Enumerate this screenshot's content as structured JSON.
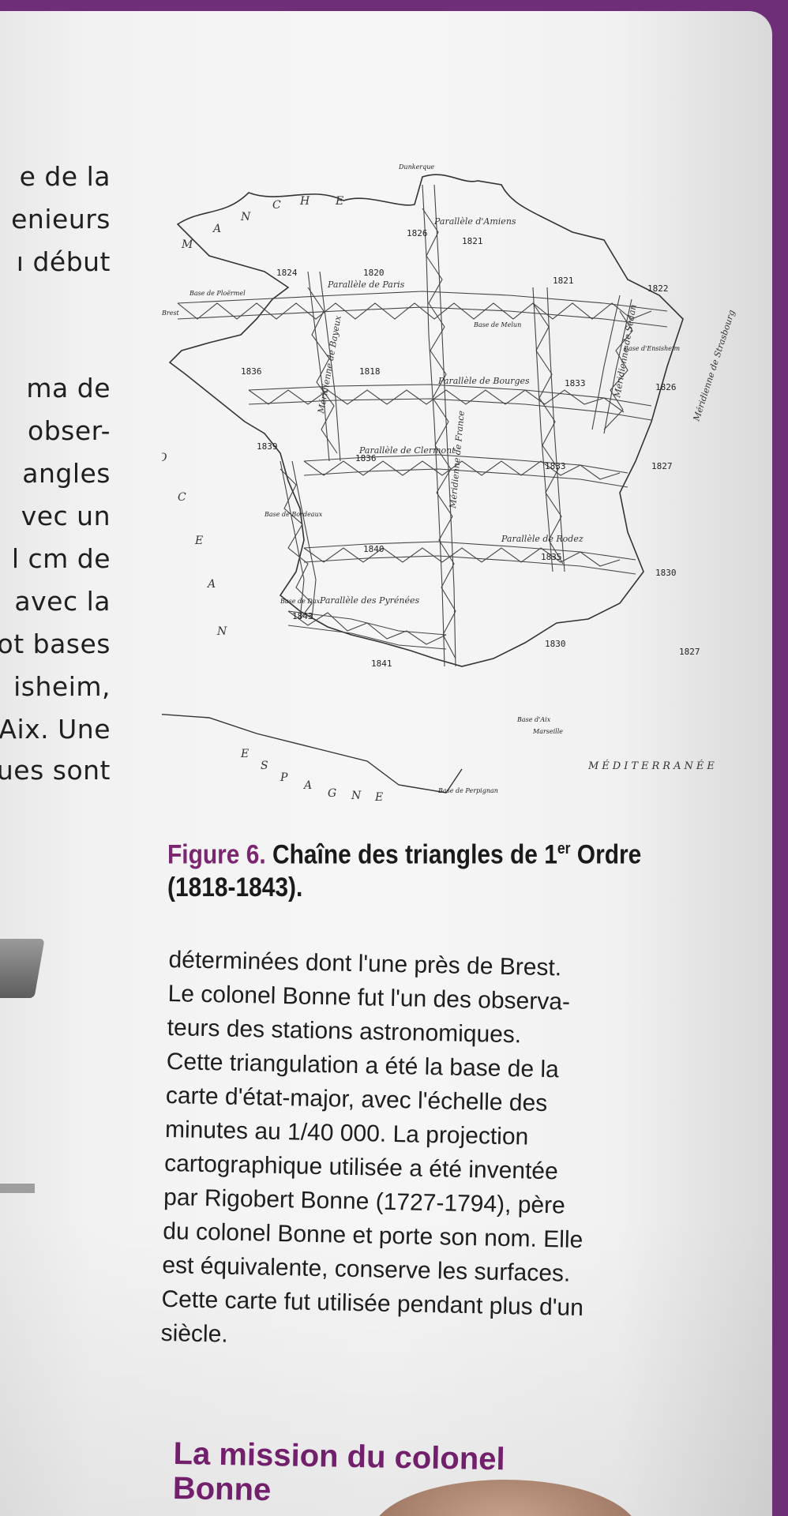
{
  "left_fragments": [
    "e de la",
    "enieurs",
    "ı début",
    "ma de",
    "obser-",
    "angles",
    "vec un",
    "l cm de",
    "avec la",
    "ot bases",
    "isheim,",
    "Aix. Une",
    "ues sont"
  ],
  "figure": {
    "number_label": "Figure 6.",
    "title_main": "Chaîne des triangles de 1",
    "title_sup": "er",
    "title_end": " Ordre",
    "title_line2": "(1818-1843)."
  },
  "map": {
    "sea_labels": {
      "manche": [
        "M",
        "A",
        "N",
        "C",
        "H",
        "E"
      ],
      "ocean": [
        "O",
        "C",
        "E",
        "A",
        "N"
      ],
      "espagne": [
        "E",
        "S",
        "P",
        "A",
        "G",
        "N",
        "E"
      ],
      "mediterranee": "MÉDITERRANÉE"
    },
    "chain_labels": [
      "Parallèle de Paris",
      "Parallèle de Bourges",
      "Parallèle de Clermont",
      "Parallèle de Rodez",
      "Parallèle des Pyrénées",
      "Méridienne de France",
      "Méridienne de Sedan",
      "Méridienne de Strasbourg",
      "Parallèle d'Amiens",
      "Méridienne de Bayeux"
    ],
    "place_labels": [
      "Dunkerque",
      "Brest",
      "Base de Melun",
      "Base de Bordeaux",
      "Base de Dax",
      "Base de Perpignan",
      "Base d'Aix",
      "Marseille",
      "Base de Ploërmel",
      "Base d'Ensisheim"
    ],
    "years": [
      "1826",
      "1821",
      "1824",
      "1820",
      "1821",
      "1822",
      "1836",
      "1818",
      "1833",
      "1826",
      "1839",
      "1836",
      "1833",
      "1827",
      "1840",
      "1835",
      "1830",
      "1843",
      "1830",
      "1827",
      "1841"
    ]
  },
  "body_lines": [
    "déterminées dont l'une près de Brest.",
    "Le colonel Bonne fut l'un des observa-",
    "teurs des stations astronomiques.",
    "Cette triangulation a été la base de la",
    "carte d'état-major, avec l'échelle des",
    "minutes au 1/40 000. La projection",
    "cartographique utilisée a été inventée",
    "par Rigobert Bonne (1727-1794), père",
    "du colonel Bonne et porte son nom. Elle",
    "est équivalente, conserve les surfaces.",
    "Cette carte fut utilisée pendant plus d'un",
    "siècle."
  ],
  "section_title": [
    "La mission du colonel",
    "Bonne"
  ]
}
